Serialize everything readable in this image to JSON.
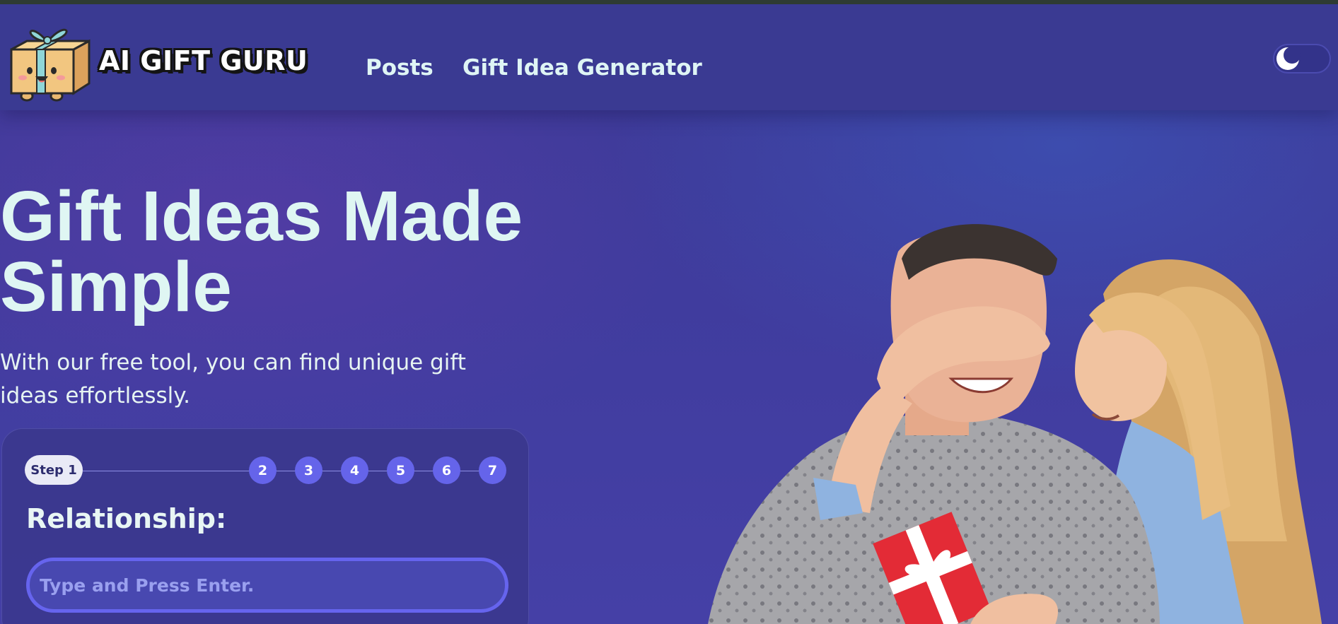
{
  "brand": {
    "name": "AI GIFT GURU",
    "logo_icon": "gift-box-mascot-icon"
  },
  "nav": {
    "posts": "Posts",
    "generator": "Gift Idea Generator"
  },
  "theme_toggle": {
    "icon": "moon-icon",
    "mode": "dark"
  },
  "hero": {
    "title_line1": "Gift Ideas Made",
    "title_line2": "Simple",
    "subtitle_line1": "With our free tool, you can find unique gift",
    "subtitle_line2": "ideas effortlessly."
  },
  "form": {
    "current_step_label": "Step 1",
    "steps": [
      "2",
      "3",
      "4",
      "5",
      "6",
      "7"
    ],
    "question": "Relationship:",
    "input_placeholder": "Type and Press Enter.",
    "input_value": ""
  },
  "colors": {
    "background": "#3d3b96",
    "header": "#3a3a92",
    "accent": "#6564ea",
    "heading_text": "#dff6f3"
  }
}
